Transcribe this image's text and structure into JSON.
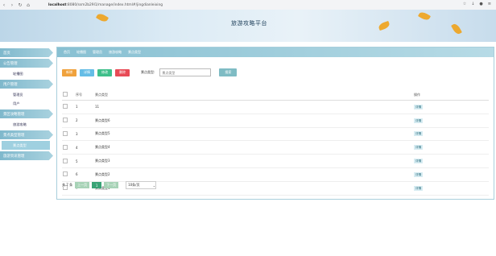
{
  "browser": {
    "url_prefix": "localhost",
    "url_rest": ":8080/ssm2b29l1/manage/index.html#/jingdianleixing"
  },
  "header": {
    "title": "旅游攻略平台"
  },
  "sidebar": {
    "items": [
      {
        "label": "首页"
      },
      {
        "label": "公告管理",
        "subs": [
          "轮播图"
        ]
      },
      {
        "label": "用户管理",
        "subs": [
          "管理员",
          "用户"
        ]
      },
      {
        "label": "景区攻略管理",
        "subs": [
          "旅游攻略"
        ]
      },
      {
        "label": "景点类型管理",
        "subs": [
          "景点类型"
        ]
      },
      {
        "label": "旅游资讯管理",
        "subs": []
      }
    ]
  },
  "breadcrumb": [
    "首页",
    "轮播图",
    "管理员",
    "旅游攻略",
    "景点类型"
  ],
  "toolbar": {
    "add": "新增",
    "detail": "详情",
    "edit": "修改",
    "delete": "删除",
    "search_label": "景点类型:",
    "search_placeholder": "景点类型",
    "search_button": "搜索"
  },
  "table": {
    "headers": [
      "序号",
      "景点类型",
      "操作"
    ],
    "rows": [
      {
        "no": "1",
        "type": "11",
        "action": "详情"
      },
      {
        "no": "2",
        "type": "景点类型6",
        "action": "详情"
      },
      {
        "no": "3",
        "type": "景点类型5",
        "action": "详情"
      },
      {
        "no": "4",
        "type": "景点类型4",
        "action": "详情"
      },
      {
        "no": "5",
        "type": "景点类型3",
        "action": "详情"
      },
      {
        "no": "6",
        "type": "景点类型2",
        "action": "详情"
      },
      {
        "no": "7",
        "type": "景点类型1",
        "action": "详情"
      }
    ]
  },
  "pager": {
    "total": "共 7 条",
    "prev": "上一页",
    "page": "1",
    "next": "下一页",
    "size": "10条/页"
  },
  "colors": {
    "add": "#f0a23d",
    "detail": "#65bde6",
    "edit": "#3fbf8a",
    "delete": "#e84b56"
  }
}
